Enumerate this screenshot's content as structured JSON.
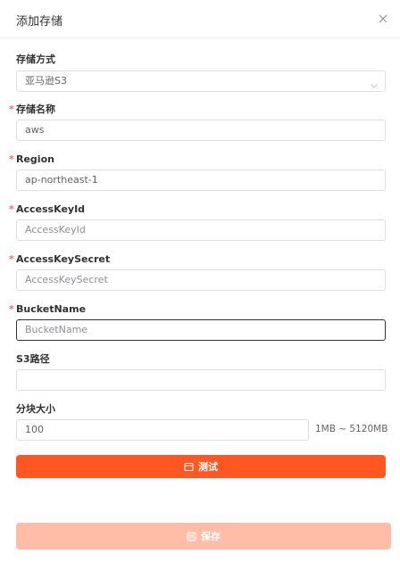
{
  "dialog": {
    "title": "添加存储",
    "close_icon": "close-icon"
  },
  "form": {
    "storage_type": {
      "label": "存储方式",
      "required": false,
      "value": "亚马逊S3"
    },
    "storage_name": {
      "label": "存储名称",
      "required": true,
      "value": "aws"
    },
    "region": {
      "label": "Region",
      "required": true,
      "value": "ap-northeast-1"
    },
    "access_key_id": {
      "label": "AccessKeyId",
      "required": true,
      "placeholder": "AccessKeyId"
    },
    "access_key_secret": {
      "label": "AccessKeySecret",
      "required": true,
      "placeholder": "AccessKeySecret"
    },
    "bucket_name": {
      "label": "BucketName",
      "required": true,
      "placeholder": "BucketName"
    },
    "s3_path": {
      "label": "S3路径",
      "required": false,
      "value": ""
    },
    "chunk_size": {
      "label": "分块大小",
      "required": false,
      "value": "100",
      "hint": "1MB ~ 5120MB"
    },
    "required_mark": "*"
  },
  "buttons": {
    "test_label": "测试",
    "test_icon": "calendar-icon",
    "save_label": "保存",
    "save_icon": "save-icon"
  },
  "colors": {
    "accent": "#ff5722",
    "accent_disabled": "#ffbca6",
    "required": "#f56c6c"
  }
}
